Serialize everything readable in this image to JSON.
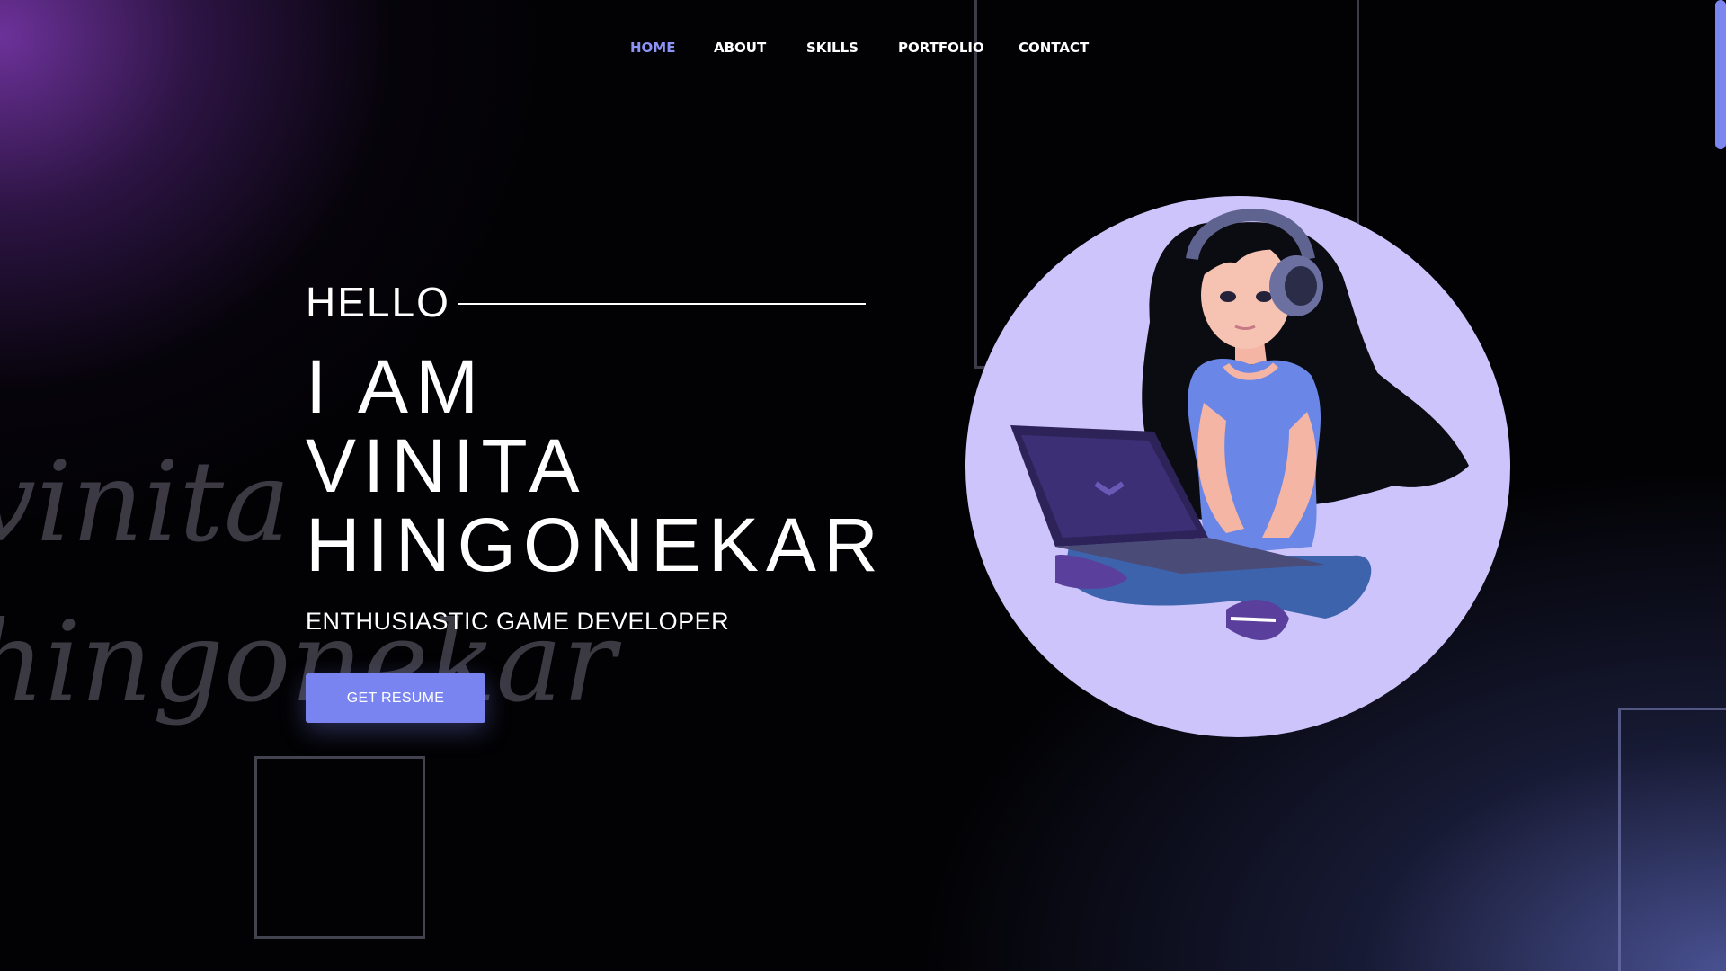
{
  "nav": {
    "items": [
      {
        "label": "HOME",
        "active": true
      },
      {
        "label": "ABOUT",
        "active": false
      },
      {
        "label": "SKILLS",
        "active": false
      },
      {
        "label": "PORTFOLIO",
        "active": false
      },
      {
        "label": "CONTACT",
        "active": false
      }
    ]
  },
  "hero": {
    "greeting": "HELLO",
    "name_lines": [
      "I AM",
      "VINITA",
      "HINGONEKAR"
    ],
    "tagline": "ENTHUSIASTIC GAME DEVELOPER",
    "resume_button": "GET RESUME"
  },
  "watermark": {
    "lines": [
      "vinita",
      "hingonekar"
    ]
  },
  "avatar": {
    "icon": "girl-with-headphones-and-laptop-illustration"
  },
  "colors": {
    "accent": "#7a84f1",
    "active_nav": "#8b95f8",
    "avatar_background": "#cdc4fb",
    "background": "#020204"
  }
}
